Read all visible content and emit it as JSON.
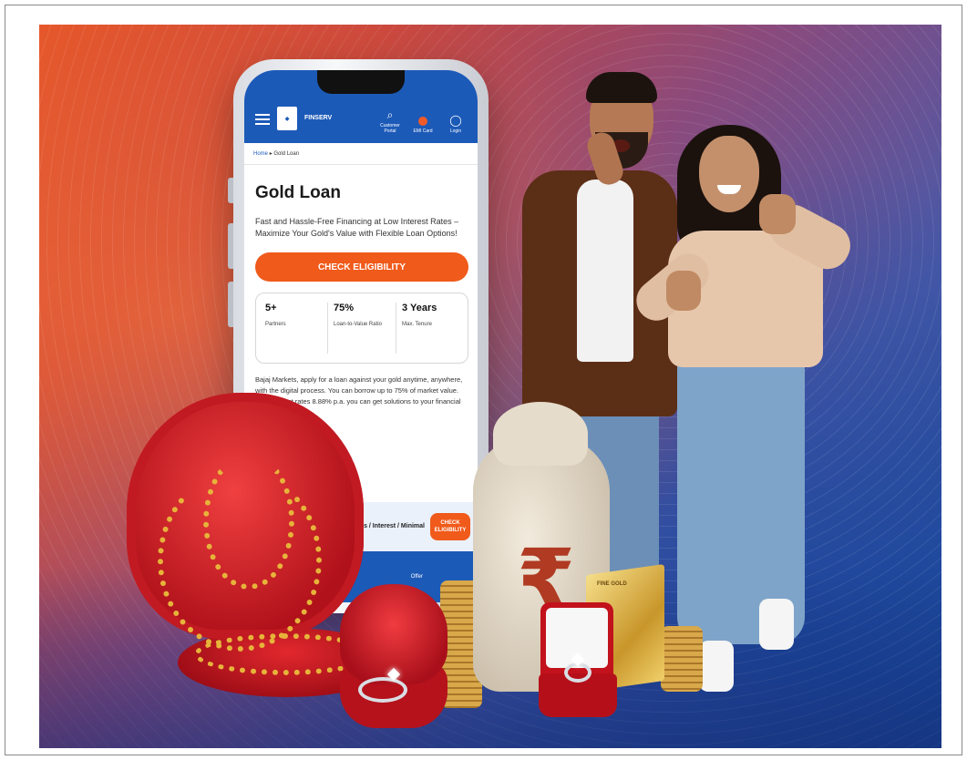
{
  "app": {
    "brand": "FINSERV",
    "header_icons": [
      {
        "name": "search-icon",
        "label": "Customer Portal"
      },
      {
        "name": "card-icon",
        "label": "EMI Card"
      },
      {
        "name": "user-icon",
        "label": "Login"
      }
    ],
    "breadcrumb": {
      "home": "Home",
      "separator": "▸",
      "current": "Gold Loan"
    },
    "page_title": "Gold Loan",
    "description": "Fast and Hassle-Free Financing at Low Interest Rates – Maximize Your Gold's Value with Flexible Loan Options!",
    "cta_label": "CHECK ELIGIBILITY",
    "stats": [
      {
        "value": "5+",
        "label": "Partners"
      },
      {
        "value": "75%",
        "label": "Loan-to-Value Ratio"
      },
      {
        "value": "3 Years",
        "label": "Max. Tenure"
      }
    ],
    "body_text": "Bajaj Markets, apply for a loan against your gold anytime, anywhere, with the digital process. You can borrow up to 75% of market value. With interest rates 8.88% p.a. you can get solutions to your financial problems",
    "sticky_bar": {
      "text": "ts / Interest / Minimal",
      "button_label": "CHECK ELIGIBILITY"
    },
    "bottom_nav_label": "Offer"
  },
  "gold_bar_text": "FINE GOLD",
  "colors": {
    "brand_blue": "#1c5ab8",
    "cta_orange": "#f05a1a",
    "velvet_red": "#c2121c",
    "gold": "#e7b33a"
  }
}
